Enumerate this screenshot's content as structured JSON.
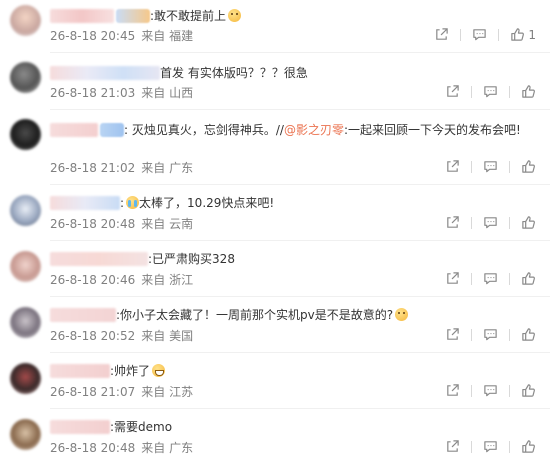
{
  "comments": [
    {
      "text": "敢不敢提前上",
      "time": "26-8-18 20:45",
      "from": "来自",
      "location": "福建",
      "likes": "1",
      "emoji": "wink"
    },
    {
      "text": "首发 有实体版吗？？？很急",
      "time": "26-8-18 21:03",
      "from": "来自",
      "location": "山西"
    },
    {
      "text_before": "灭烛见真火，忘剑得神兵。//",
      "mention": "@影之刃零",
      "text_after": ":一起来回顾一下今天的发布会吧!",
      "time": "26-8-18 21:02",
      "from": "来自",
      "location": "广东"
    },
    {
      "text": "太棒了，10.29快点来吧!",
      "time": "26-8-18 20:48",
      "from": "来自",
      "location": "云南",
      "emoji": "cry"
    },
    {
      "text": "已严肃购买328",
      "time": "26-8-18 20:46",
      "from": "来自",
      "location": "浙江"
    },
    {
      "text": "你小子太会藏了！一周前那个实机pv是不是故意的?",
      "time": "26-8-18 20:52",
      "from": "来自",
      "location": "美国",
      "emoji": "wink"
    },
    {
      "text": "帅炸了",
      "time": "26-8-18 21:07",
      "from": "来自",
      "location": "江苏",
      "emoji": "grin"
    },
    {
      "text": "需要demo",
      "time": "26-8-18 20:48",
      "from": "来自",
      "location": "广东"
    }
  ],
  "colors": {
    "text": "#333333",
    "meta": "#808080",
    "mention": "#eb7350",
    "divider": "#f0f0f0"
  },
  "icons": [
    "share-icon",
    "comment-icon",
    "like-icon"
  ]
}
